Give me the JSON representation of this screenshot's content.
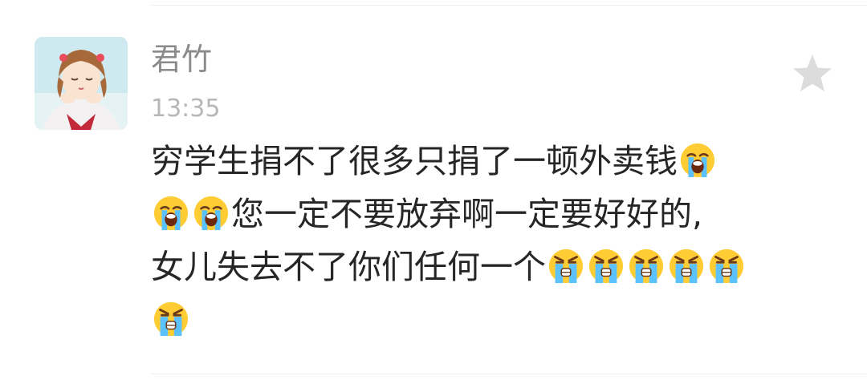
{
  "comment": {
    "username": "君竹",
    "time": "13:35",
    "lines": [
      "穷学生捐不了很多只捐了一顿外卖钱",
      "您一定不要放弃啊一定要好好的,",
      "女儿失去不了你们任何一个"
    ]
  },
  "icons": {
    "star": "star-icon",
    "sob": "loudly-crying-face-emoji",
    "cry": "crying-face-emoji"
  },
  "colors": {
    "username": "#8a8a8a",
    "time": "#b7b7b7",
    "text": "#262626",
    "star": "#dcdcdc"
  }
}
